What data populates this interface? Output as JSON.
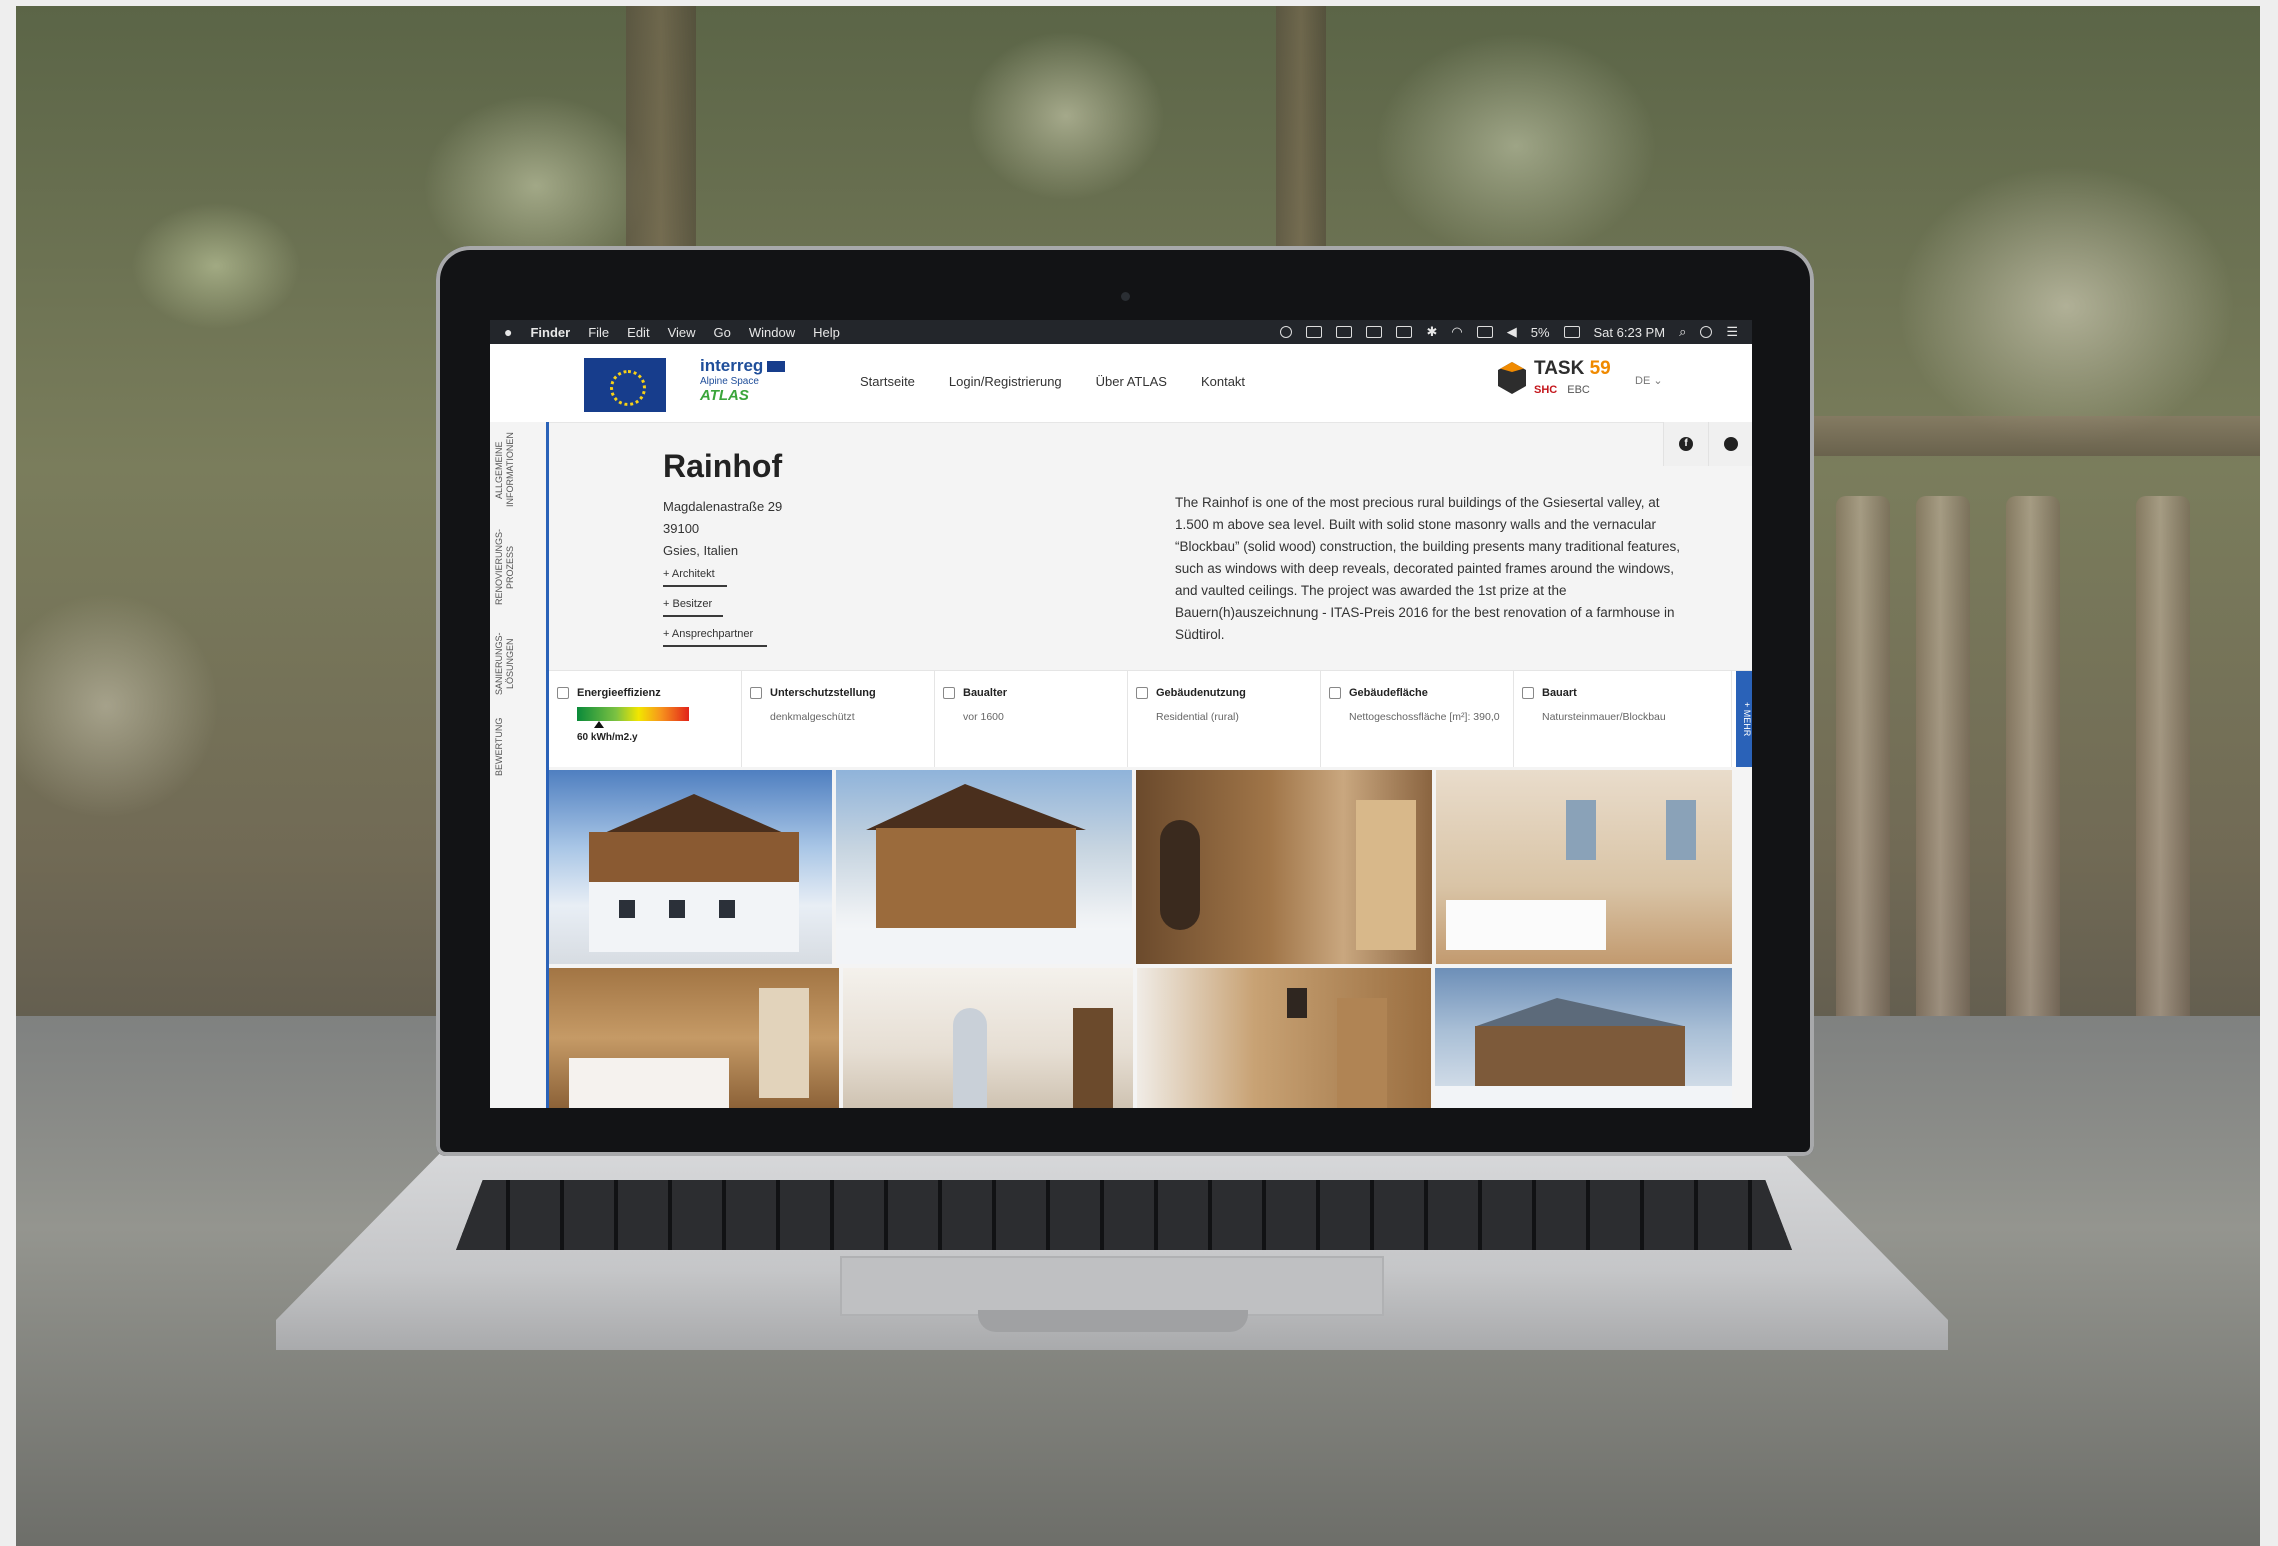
{
  "menubar": {
    "apple": "",
    "items": [
      "Finder",
      "File",
      "Edit",
      "View",
      "Go",
      "Window",
      "Help"
    ],
    "battery": "5%",
    "clock": "Sat 6:23 PM"
  },
  "header": {
    "interreg": "interreg",
    "program": "Alpine Space",
    "project": "ATLAS",
    "nav": [
      "Startseite",
      "Login/Registrierung",
      "Über ATLAS",
      "Kontakt"
    ],
    "task": "TASK",
    "task_num": "59",
    "task_sub": "SHC",
    "task_sub2": "EBC",
    "language": "DE"
  },
  "sidebar": {
    "tabs": [
      "ALLGEMEINE INFORMATIONEN",
      "RENOVIERUNGS-PROZESS",
      "SANIERUNGS-LÖSUNGEN",
      "BEWERTUNG"
    ]
  },
  "building": {
    "name": "Rainhof",
    "street": "Magdalenastraße 29",
    "zip": "39100",
    "city": "Gsies, Italien",
    "expanders": [
      "+ Architekt",
      "+ Besitzer",
      "+ Ansprechpartner"
    ],
    "description": "The Rainhof is one of the most precious rural buildings of the Gsiesertal valley, at 1.500 m above sea level. Built with solid stone masonry walls and the vernacular “Blockbau” (solid wood) construction, the building presents many traditional features, such as windows with deep reveals, decorated painted frames around the windows, and vaulted ceilings. The project was awarded the 1st prize at the Bauern(h)auszeichnung - ITAS-Preis 2016 for the best renovation of a farmhouse in Südtirol."
  },
  "facts": [
    {
      "label": "Energieeffizienz",
      "value": "60 kWh/m2.y",
      "icon": "energy-icon"
    },
    {
      "label": "Unterschutzstellung",
      "value": "denkmalgeschützt",
      "icon": "protection-icon"
    },
    {
      "label": "Baualter",
      "value": "vor 1600",
      "icon": "calendar-icon"
    },
    {
      "label": "Gebäudenutzung",
      "value": "Residential (rural)",
      "icon": "house-icon"
    },
    {
      "label": "Gebäudefläche",
      "value": "Nettogeschossfläche [m²]: 390,0",
      "icon": "area-icon"
    },
    {
      "label": "Bauart",
      "value": "Natursteinmauer/Blockbau",
      "icon": "construction-icon"
    }
  ],
  "mehr_label": "+ MEHR",
  "energy_level": 0.2,
  "icons": {
    "info": "info-icon",
    "share": "share-icon"
  }
}
